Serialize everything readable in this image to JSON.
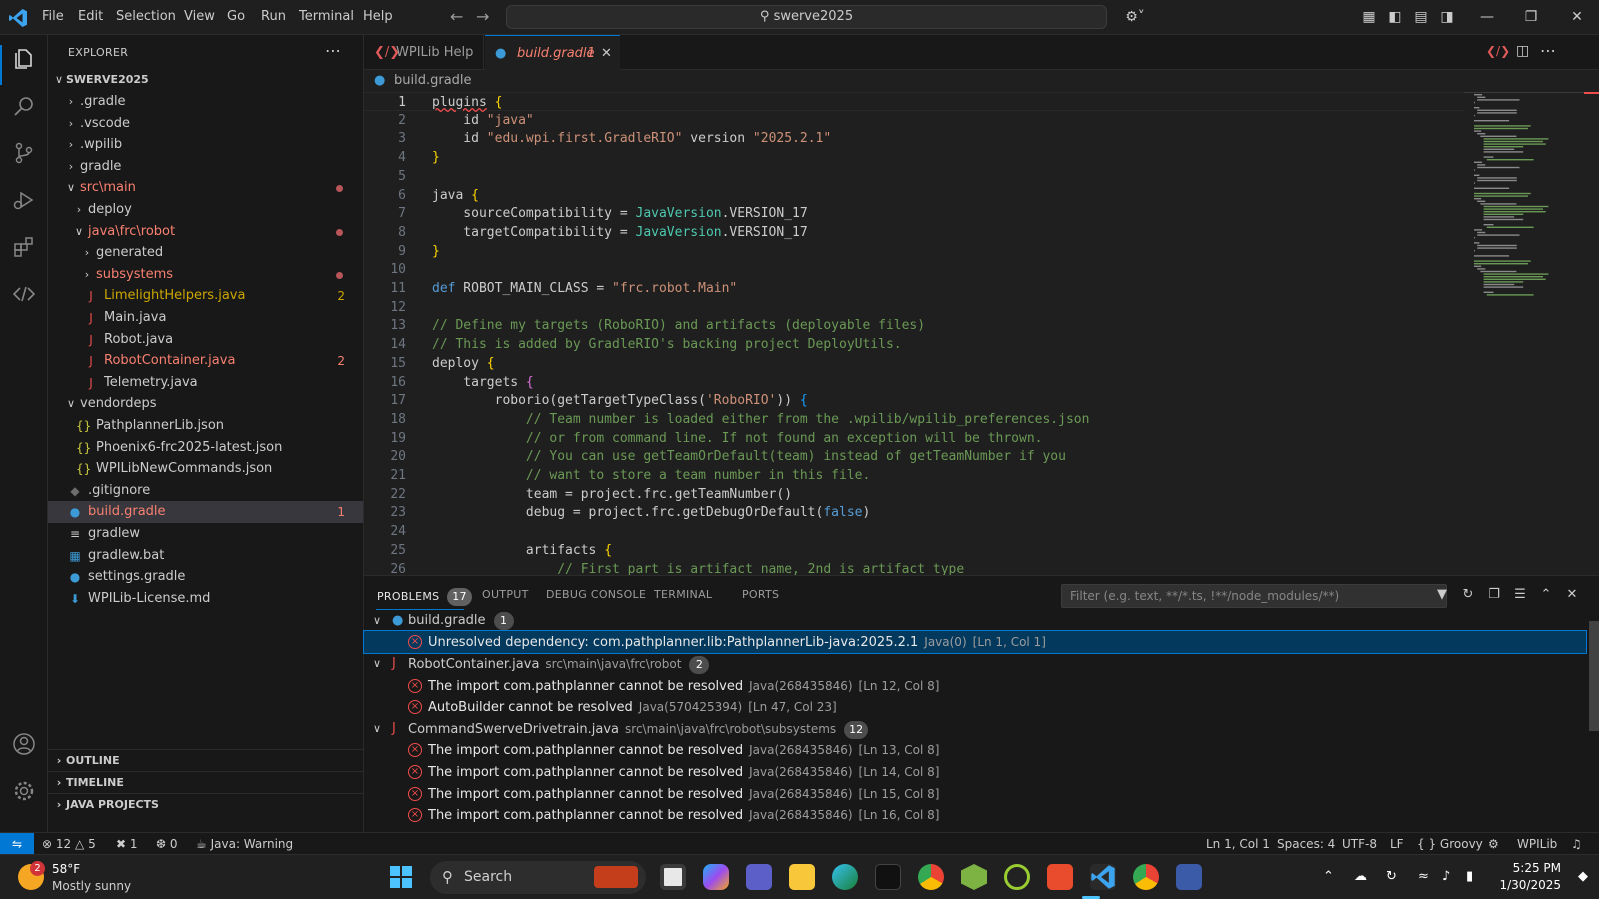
{
  "titlebar": {
    "menu": [
      "File",
      "Edit",
      "Selection",
      "View",
      "Go",
      "Run",
      "Terminal",
      "Help"
    ],
    "search": "swerve2025"
  },
  "explorer": {
    "title": "EXPLORER",
    "root": "SWERVE2025",
    "rows": [
      {
        "label": ".gradle",
        "kind": "folder",
        "depth": 1,
        "open": false
      },
      {
        "label": ".vscode",
        "kind": "folder",
        "depth": 1,
        "open": false
      },
      {
        "label": ".wpilib",
        "kind": "folder",
        "depth": 1,
        "open": false
      },
      {
        "label": "gradle",
        "kind": "folder",
        "depth": 1,
        "open": false
      },
      {
        "label": "src\\main",
        "kind": "folder",
        "depth": 1,
        "open": true,
        "error": true
      },
      {
        "label": "deploy",
        "kind": "folder",
        "depth": 2,
        "open": false
      },
      {
        "label": "java\\frc\\robot",
        "kind": "folder",
        "depth": 2,
        "open": true,
        "error": true
      },
      {
        "label": "generated",
        "kind": "folder",
        "depth": 3,
        "open": false
      },
      {
        "label": "subsystems",
        "kind": "folder",
        "depth": 3,
        "open": false,
        "error": true
      },
      {
        "label": "LimelightHelpers.java",
        "kind": "java",
        "depth": 3,
        "warn": true,
        "count": "2"
      },
      {
        "label": "Main.java",
        "kind": "java",
        "depth": 3
      },
      {
        "label": "Robot.java",
        "kind": "java",
        "depth": 3
      },
      {
        "label": "RobotContainer.java",
        "kind": "java",
        "depth": 3,
        "error": true,
        "count": "2"
      },
      {
        "label": "Telemetry.java",
        "kind": "java",
        "depth": 3
      },
      {
        "label": "vendordeps",
        "kind": "folder",
        "depth": 1,
        "open": true
      },
      {
        "label": "PathplannerLib.json",
        "kind": "json",
        "depth": 2
      },
      {
        "label": "Phoenix6-frc2025-latest.json",
        "kind": "json",
        "depth": 2
      },
      {
        "label": "WPILibNewCommands.json",
        "kind": "json",
        "depth": 2
      },
      {
        "label": ".gitignore",
        "kind": "git",
        "depth": 1
      },
      {
        "label": "build.gradle",
        "kind": "gradle",
        "depth": 1,
        "selected": true,
        "error": true,
        "count": "1"
      },
      {
        "label": "gradlew",
        "kind": "text",
        "depth": 1
      },
      {
        "label": "gradlew.bat",
        "kind": "bat",
        "depth": 1
      },
      {
        "label": "settings.gradle",
        "kind": "gradle",
        "depth": 1
      },
      {
        "label": "WPILib-License.md",
        "kind": "md",
        "depth": 1
      }
    ],
    "sections": [
      "OUTLINE",
      "TIMELINE",
      "JAVA PROJECTS"
    ]
  },
  "tabs": [
    {
      "label": "WPILib Help"
    },
    {
      "label": "build.gradle",
      "count": "1"
    }
  ],
  "breadcrumb": "build.gradle",
  "code": [
    [
      [
        "plugins",
        "p"
      ],
      [
        " {",
        "y"
      ]
    ],
    [
      [
        "    id ",
        "p"
      ],
      [
        "\"java\"",
        "s"
      ]
    ],
    [
      [
        "    id ",
        "p"
      ],
      [
        "\"edu.wpi.first.GradleRIO\"",
        "s"
      ],
      [
        " version ",
        "p"
      ],
      [
        "\"2025.2.1\"",
        "s"
      ]
    ],
    [
      [
        "}",
        "y"
      ]
    ],
    [],
    [
      [
        "java",
        "p"
      ],
      [
        " {",
        "y"
      ]
    ],
    [
      [
        "    sourceCompatibility = ",
        "p"
      ],
      [
        "JavaVersion",
        "t"
      ],
      [
        ".VERSION_17",
        "p"
      ]
    ],
    [
      [
        "    targetCompatibility = ",
        "p"
      ],
      [
        "JavaVersion",
        "t"
      ],
      [
        ".VERSION_17",
        "p"
      ]
    ],
    [
      [
        "}",
        "y"
      ]
    ],
    [],
    [
      [
        "def",
        "k"
      ],
      [
        " ROBOT_MAIN_CLASS = ",
        "p"
      ],
      [
        "\"frc.robot.Main\"",
        "s"
      ]
    ],
    [],
    [
      [
        "// Define my targets (RoboRIO) and artifacts (deployable files)",
        "c"
      ]
    ],
    [
      [
        "// This is added by GradleRIO's backing project DeployUtils.",
        "c"
      ]
    ],
    [
      [
        "deploy",
        "p"
      ],
      [
        " {",
        "y"
      ]
    ],
    [
      [
        "    targets ",
        "p"
      ],
      [
        "{",
        "m"
      ]
    ],
    [
      [
        "        roborio(getTargetTypeClass(",
        "p"
      ],
      [
        "'RoboRIO'",
        "s"
      ],
      [
        ")) ",
        "p"
      ],
      [
        "{",
        "b"
      ]
    ],
    [
      [
        "            // Team number is loaded either from the .wpilib/wpilib_preferences.json",
        "c"
      ]
    ],
    [
      [
        "            // or from command line. If not found an exception will be thrown.",
        "c"
      ]
    ],
    [
      [
        "            // You can use getTeamOrDefault(team) instead of getTeamNumber if you",
        "c"
      ]
    ],
    [
      [
        "            // want to store a team number in this file.",
        "c"
      ]
    ],
    [
      [
        "            team = project.frc.getTeamNumber()",
        "p"
      ]
    ],
    [
      [
        "            debug = project.frc.getDebugOrDefault(",
        "p"
      ],
      [
        "false",
        "k"
      ],
      [
        ")",
        "p"
      ]
    ],
    [],
    [
      [
        "            artifacts ",
        "p"
      ],
      [
        "{",
        "y"
      ]
    ],
    [
      [
        "                // First part is artifact name, 2nd is artifact type",
        "c"
      ]
    ]
  ],
  "panel": {
    "tabs": [
      "PROBLEMS",
      "OUTPUT",
      "DEBUG CONSOLE",
      "TERMINAL",
      "PORTS"
    ],
    "problems_count": "17",
    "filter_placeholder": "Filter (e.g. text, **/*.ts, !**/node_modules/**)",
    "rows": [
      {
        "type": "file",
        "name": "build.gradle",
        "path": "",
        "count": "1",
        "icon": "gradle"
      },
      {
        "type": "error",
        "msg": "Unresolved dependency: com.pathplanner.lib:PathplannerLib-java:2025.2.1",
        "src": "Java(0)",
        "loc": "[Ln 1, Col 1]",
        "selected": true
      },
      {
        "type": "file",
        "name": "RobotContainer.java",
        "path": "src\\main\\java\\frc\\robot",
        "count": "2",
        "icon": "java"
      },
      {
        "type": "error",
        "msg": "The import com.pathplanner cannot be resolved",
        "src": "Java(268435846)",
        "loc": "[Ln 12, Col 8]"
      },
      {
        "type": "error",
        "msg": "AutoBuilder cannot be resolved",
        "src": "Java(570425394)",
        "loc": "[Ln 47, Col 23]"
      },
      {
        "type": "file",
        "name": "CommandSwerveDrivetrain.java",
        "path": "src\\main\\java\\frc\\robot\\subsystems",
        "count": "12",
        "icon": "java"
      },
      {
        "type": "error",
        "msg": "The import com.pathplanner cannot be resolved",
        "src": "Java(268435846)",
        "loc": "[Ln 13, Col 8]"
      },
      {
        "type": "error",
        "msg": "The import com.pathplanner cannot be resolved",
        "src": "Java(268435846)",
        "loc": "[Ln 14, Col 8]"
      },
      {
        "type": "error",
        "msg": "The import com.pathplanner cannot be resolved",
        "src": "Java(268435846)",
        "loc": "[Ln 15, Col 8]"
      },
      {
        "type": "error",
        "msg": "The import com.pathplanner cannot be resolved",
        "src": "Java(268435846)",
        "loc": "[Ln 16, Col 8]"
      }
    ]
  },
  "statusbar": {
    "errors": "12",
    "warnings": "5",
    "ports": "1",
    "info": "0",
    "java": "Java: Warning",
    "position": "Ln 1, Col 1",
    "spaces": "Spaces: 4",
    "encoding": "UTF-8",
    "eol": "LF",
    "language": "Groovy",
    "extension": "WPILib"
  },
  "taskbar": {
    "weather_temp": "58°F",
    "weather_desc": "Mostly sunny",
    "weather_badge": "2",
    "search": "Search",
    "time": "5:25 PM",
    "date": "1/30/2025"
  },
  "colors": {
    "accent": "#0078d4",
    "error": "#f14c4c",
    "keyword": "#569cd6",
    "string": "#ce9178",
    "comment": "#6a9955",
    "type": "#4ec9b0",
    "java_icon": "#e84c4c",
    "json_icon": "#cbcb41",
    "gradle_icon": "#3c9ad6"
  }
}
